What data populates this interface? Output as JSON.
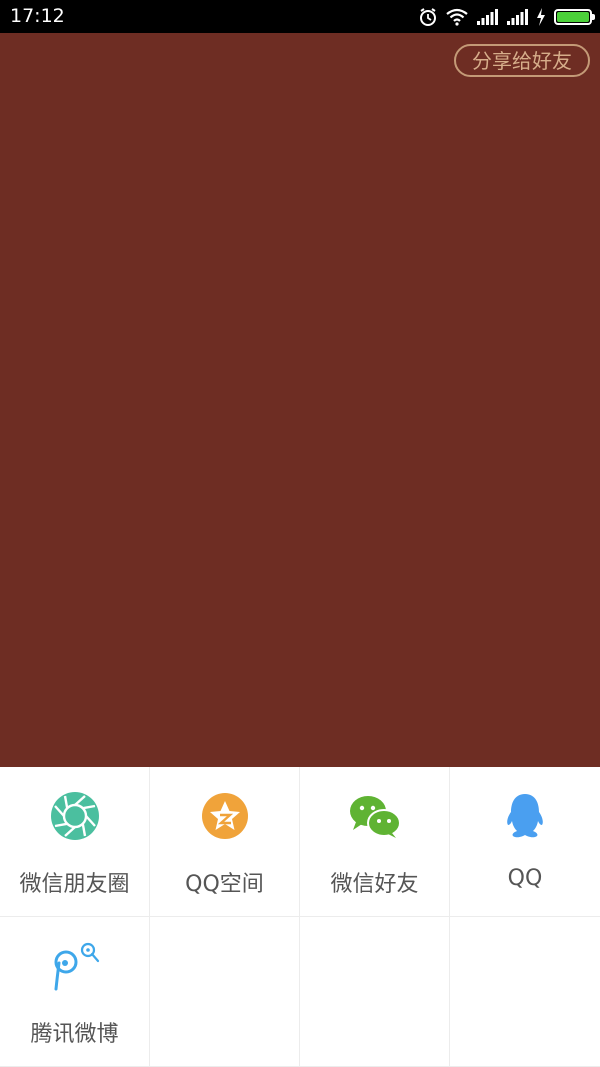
{
  "status_bar": {
    "time": "17:12",
    "icons": [
      "alarm-icon",
      "wifi-icon",
      "signal-icon",
      "signal-icon",
      "charging-icon",
      "battery-icon"
    ],
    "battery_color": "#4cd13a"
  },
  "main": {
    "background_color": "#6e2d23",
    "share_button_label": "分享给好友"
  },
  "share_panel": {
    "items": [
      {
        "label": "微信朋友圈",
        "icon": "wechat-moments-icon",
        "color": "#4bbf9f"
      },
      {
        "label": "QQ空间",
        "icon": "qzone-icon",
        "color": "#f0a33a"
      },
      {
        "label": "微信好友",
        "icon": "wechat-icon",
        "color": "#5fb333"
      },
      {
        "label": "QQ",
        "icon": "qq-icon",
        "color": "#4a9ff0"
      },
      {
        "label": "腾讯微博",
        "icon": "tencent-weibo-icon",
        "color": "#3ea7ea"
      }
    ]
  }
}
